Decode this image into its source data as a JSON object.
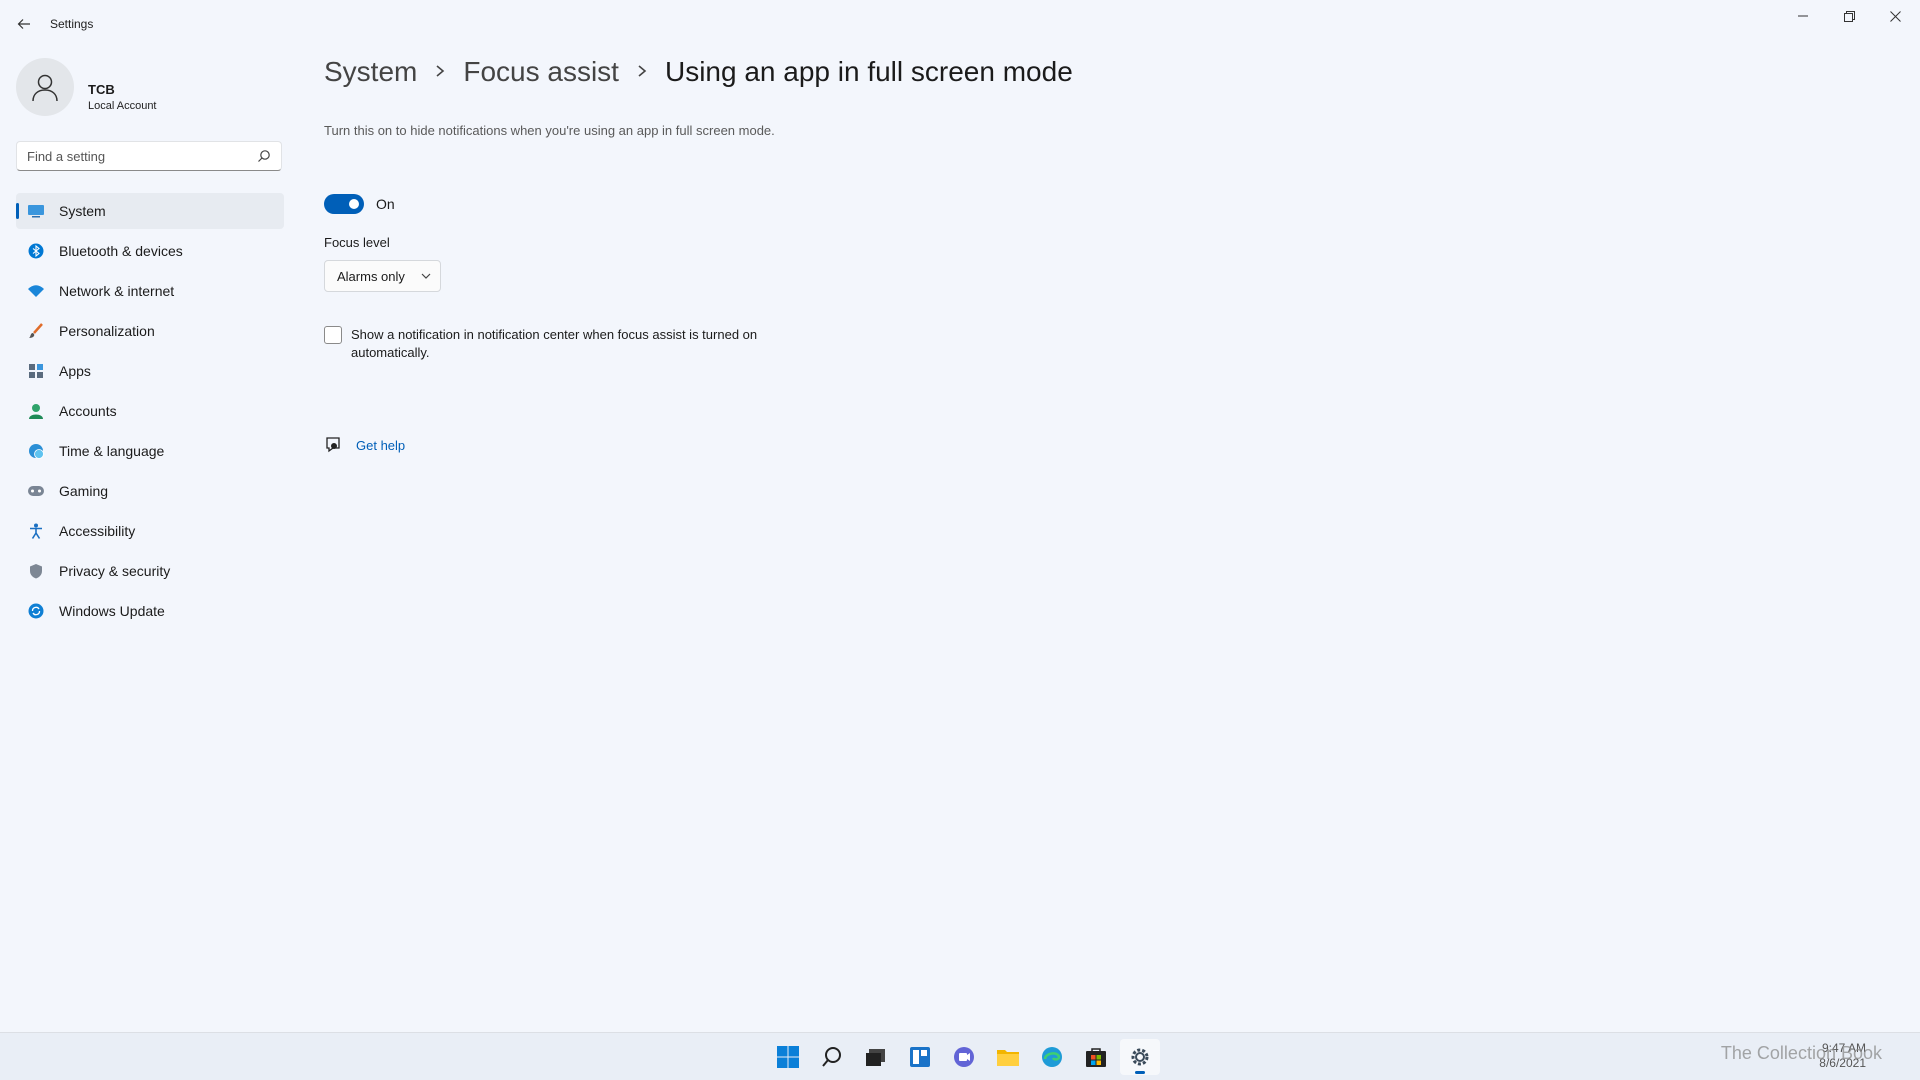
{
  "window": {
    "title": "Settings"
  },
  "profile": {
    "name": "TCB",
    "subtitle": "Local Account"
  },
  "search": {
    "placeholder": "Find a setting"
  },
  "sidebar": {
    "items": [
      {
        "label": "System",
        "icon": "monitor-icon",
        "active": true
      },
      {
        "label": "Bluetooth & devices",
        "icon": "bluetooth-icon"
      },
      {
        "label": "Network & internet",
        "icon": "wifi-icon"
      },
      {
        "label": "Personalization",
        "icon": "brush-icon"
      },
      {
        "label": "Apps",
        "icon": "apps-icon"
      },
      {
        "label": "Accounts",
        "icon": "person-icon"
      },
      {
        "label": "Time & language",
        "icon": "globe-clock-icon"
      },
      {
        "label": "Gaming",
        "icon": "gamepad-icon"
      },
      {
        "label": "Accessibility",
        "icon": "accessibility-icon"
      },
      {
        "label": "Privacy & security",
        "icon": "shield-icon"
      },
      {
        "label": "Windows Update",
        "icon": "update-icon"
      }
    ]
  },
  "breadcrumb": {
    "level1": "System",
    "level2": "Focus assist",
    "current": "Using an app in full screen mode"
  },
  "content": {
    "description": "Turn this on to hide notifications when you're using an app in full screen mode.",
    "toggle_label": "On",
    "toggle_on": true,
    "focus_level_label": "Focus level",
    "focus_level_value": "Alarms only",
    "checkbox_label": "Show a notification in notification center when focus assist is turned on automatically.",
    "checkbox_checked": false,
    "help_link": "Get help"
  },
  "taskbar": {
    "apps": [
      "windows-start-icon",
      "search-icon",
      "task-view-icon",
      "widgets-icon",
      "chat-icon",
      "file-explorer-icon",
      "edge-icon",
      "store-icon",
      "settings-icon"
    ],
    "clock_time": "9:47 AM",
    "clock_date": "8/6/2021",
    "watermark": "The Collection Book"
  },
  "colors": {
    "accent": "#005fb8",
    "background": "#f3f6fc",
    "taskbar": "#e9eef6"
  }
}
